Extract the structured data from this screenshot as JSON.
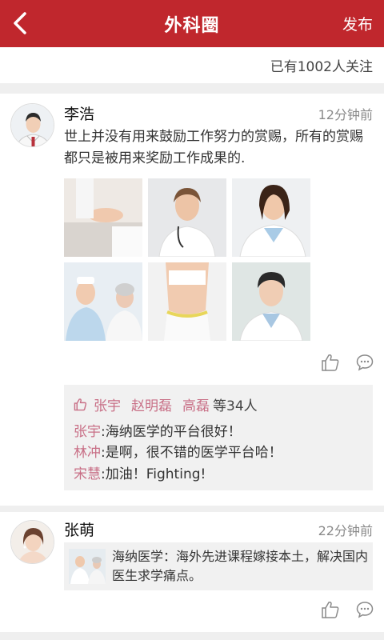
{
  "nav": {
    "title": "外科圈",
    "publish_label": "发布",
    "back_icon": "chevron-left-icon"
  },
  "colors": {
    "brand": "#c0272d",
    "name_link": "#c86f86",
    "background": "#efefef"
  },
  "follow": {
    "text": "已有1002人关注"
  },
  "posts": [
    {
      "username": "李浩",
      "time": "12分钟前",
      "text": "世上并没有用来鼓励工作努力的赏赐，所有的赏赐都只是被用来奖励工作成果的.",
      "photos": [
        "nurse-holding-patient-hand",
        "female-doctor-stethoscope",
        "smiling-female-doctor",
        "nurse-with-elderly-patient",
        "waist-measuring-tape",
        "young-male-doctor"
      ],
      "likes": {
        "names": [
          "张宇",
          "赵明磊",
          "高磊"
        ],
        "more": "等34人"
      },
      "comments": [
        {
          "name": "张宇",
          "text": ":海纳医学的平台很好！"
        },
        {
          "name": "林冲",
          "text": ":是啊，很不错的医学平台哈！"
        },
        {
          "name": "宋慧",
          "text": ":加油！Fighting!"
        }
      ]
    },
    {
      "username": "张萌",
      "time": "22分钟前",
      "share_text": "海纳医学：海外先进课程嫁接本土，解决国内医生求学痛点。"
    }
  ]
}
